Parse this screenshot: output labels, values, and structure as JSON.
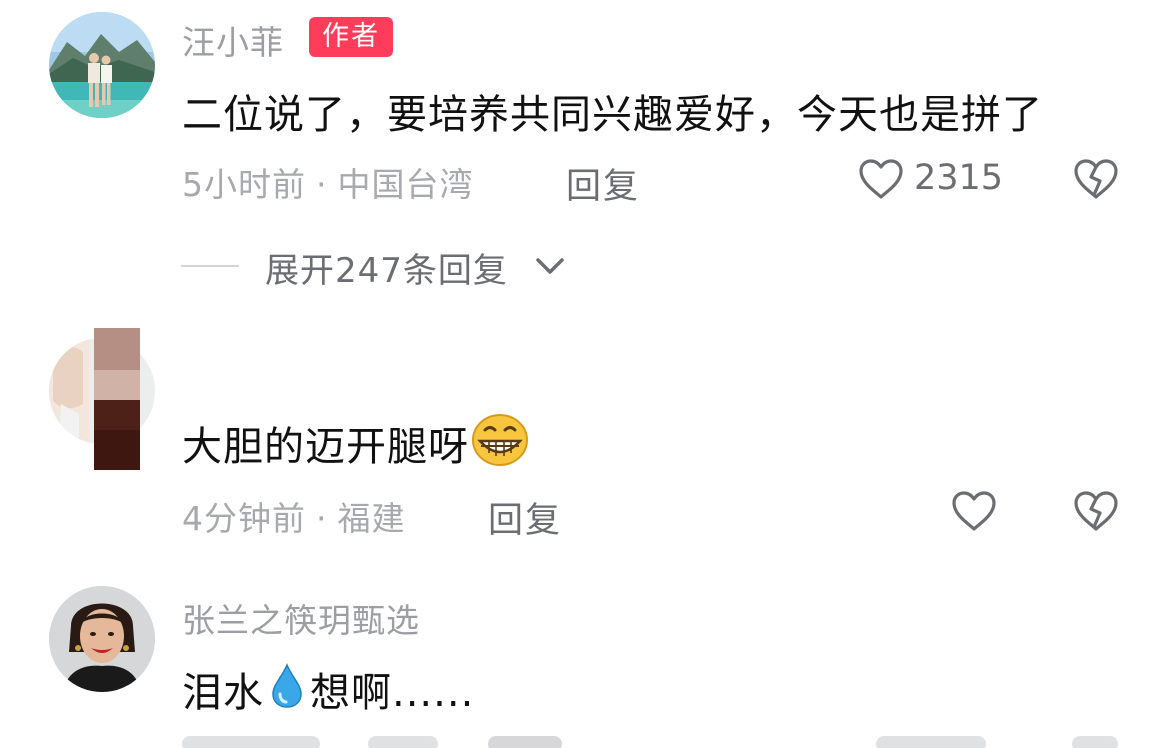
{
  "comments": [
    {
      "username": "汪小菲",
      "badge": "作者",
      "text": "二位说了，要培养共同兴趣爱好，今天也是拼了",
      "time": "5小时前",
      "location": "中国台湾",
      "reply_label": "回复",
      "like_count": "2315",
      "expand_label": "展开247条回复",
      "avatar_icon": "couple-photo-avatar"
    },
    {
      "username": "",
      "text": "大胆的迈开腿呀",
      "text_emoji": "grinning-emoji",
      "time": "4分钟前",
      "location": "福建",
      "reply_label": "回复",
      "like_count": "",
      "avatar_icon": "pixelated-avatar"
    },
    {
      "username": "张兰之筷玥甄选",
      "text_prefix": "泪水",
      "text_emoji": "droplet-emoji",
      "text_suffix": "想啊......",
      "avatar_icon": "woman-portrait-avatar"
    }
  ],
  "icons": {
    "like": "heart-outline-icon",
    "dislike": "broken-heart-icon",
    "expand": "chevron-down-icon"
  },
  "colors": {
    "author_badge": "#ff3d5b",
    "meta_text": "#a7a9ae",
    "username_text": "#9c9ea4",
    "comment_text": "#111111"
  }
}
